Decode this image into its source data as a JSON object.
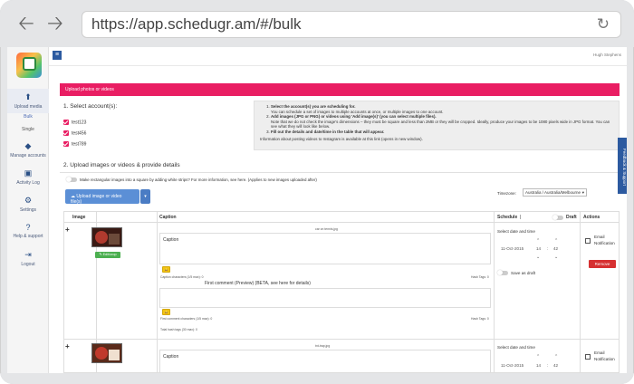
{
  "browser": {
    "url": "https://app.schedugr.am/#/bulk",
    "back_glyph": "🡠",
    "forward_glyph": "🡢",
    "reload_glyph": "↻"
  },
  "header": {
    "user_name": "Hugh Stephens",
    "menu_glyph": "≡"
  },
  "sidebar": {
    "items": [
      {
        "label": "Upload media",
        "icon": "upload-icon",
        "glyph": "⬆"
      },
      {
        "label": "Manage accounts",
        "icon": "layers-icon",
        "glyph": "◆"
      },
      {
        "label": "Activity Log",
        "icon": "activity-icon",
        "glyph": "▣"
      },
      {
        "label": "Settings",
        "icon": "gear-icon",
        "glyph": "⚙"
      },
      {
        "label": "Help & support",
        "icon": "help-icon",
        "glyph": "?"
      },
      {
        "label": "Logout",
        "icon": "logout-icon",
        "glyph": "⇥"
      }
    ],
    "subitems": [
      "Bulk",
      "Single"
    ]
  },
  "banner": {
    "title": "Upload photos or videos"
  },
  "accounts": {
    "heading": "1. Select account(s):",
    "list": [
      "test123",
      "test456",
      "test789"
    ]
  },
  "instructions": {
    "items": [
      {
        "title": "Select the account(s) you are scheduling for.",
        "detail": "You can schedule a set of images to multiple accounts at once, or multiple images to one account."
      },
      {
        "title": "Add images (JPG or PNG) or videos using 'Add image(s)' (you can select multiple files).",
        "detail": "Note that we do not check the image's dimensions – they must be square and less than 2MB or they will be cropped. Ideally, produce your images to be 1080 pixels wide in JPG format. You can see what they will look like below."
      },
      {
        "title": "Fill out the details and date/time in the table that will appear.",
        "detail": ""
      }
    ],
    "footer": "Information about posting videos to Instagram is available at this link (opens in new window)."
  },
  "upload": {
    "heading": "2. Upload images or videos & provide details",
    "square_option": "Make rectangular images into a square by adding white strips? For more information, see here. (Applies to new images uploaded after)",
    "upload_button": "Upload image or video file(s)",
    "dropdown_glyph": "▾",
    "timezone_label": "Timezone:",
    "timezone_value": "Australia / Australia/Melbourne"
  },
  "table": {
    "headers": {
      "image": "Image",
      "caption": "Caption",
      "schedule": "Schedule",
      "draft": "Draft",
      "actions": "Actions"
    },
    "rows": [
      {
        "filename": "car on tennis.jpg",
        "edit_label": "✎ Edit/crop",
        "caption_label": "Caption",
        "caption_chars": "Caption characters (1/5 max): 0",
        "hash_tags": "Hash Tags: 0",
        "first_comment": "First comment (Preview) (BETA, see here for details)",
        "comment_chars": "First comment characters (1/5 max): 0",
        "comment_hash_tags": "Hash Tags: 0",
        "total_hash_tags": "Total hash tags (30 max): 0",
        "schedule_label": "Select date and time",
        "date": "11-Oct-2015",
        "hour": "14",
        "minute": "42",
        "save_draft": "Save as draft",
        "email_label": "Email Notification",
        "remove_label": "Remove"
      },
      {
        "filename": "tnt-trap.jpg",
        "caption_label": "Caption",
        "schedule_label": "Select date and time",
        "date": "11-Oct-2015",
        "hour": "14",
        "minute": "42",
        "email_label": "Email Notification"
      }
    ]
  },
  "feedback_tab": "Feedback & Support",
  "colors": {
    "accent": "#e91e63",
    "primary": "#2c5aa0",
    "danger": "#d63031",
    "success": "#4caf50"
  }
}
